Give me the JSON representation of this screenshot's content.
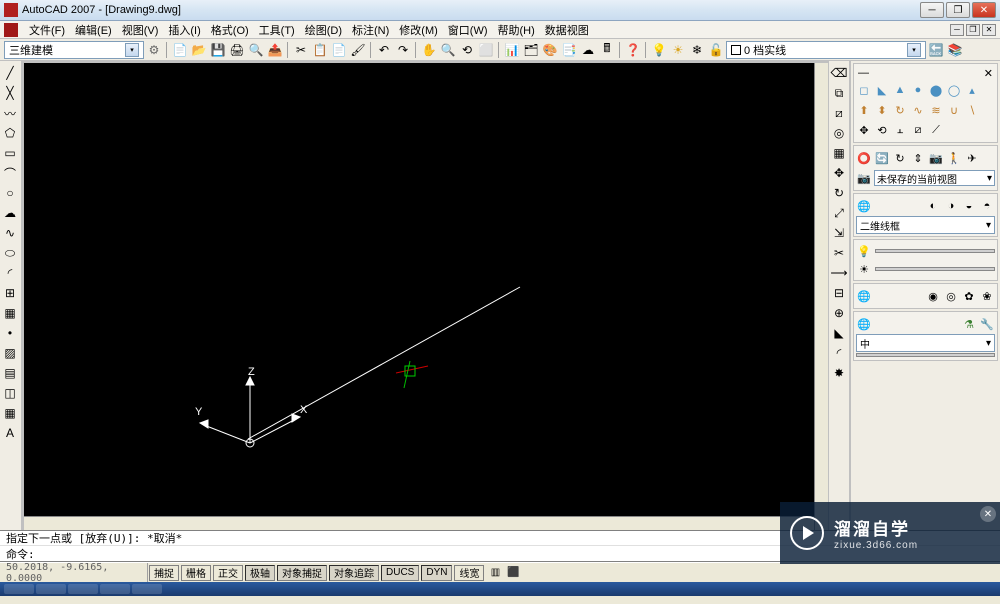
{
  "window": {
    "title": "AutoCAD 2007 - [Drawing9.dwg]"
  },
  "menu": [
    "文件(F)",
    "编辑(E)",
    "视图(V)",
    "插入(I)",
    "格式(O)",
    "工具(T)",
    "绘图(D)",
    "标注(N)",
    "修改(M)",
    "窗口(W)",
    "帮助(H)",
    "数据视图"
  ],
  "workspace": "三维建模",
  "layer_label": "0 档实线",
  "right_panel": {
    "view_dd": "未保存的当前视图",
    "style_dd": "二维线框",
    "hatch_dd": "中"
  },
  "command": {
    "output": "指定下一点或 [放弃(U)]: *取消*",
    "prompt": "命令:"
  },
  "status": {
    "coords": "50.2018, -9.6165, 0.0000",
    "buttons": [
      "捕捉",
      "栅格",
      "正交",
      "极轴",
      "对象捕捉",
      "对象追踪",
      "DUCS",
      "DYN",
      "线宽"
    ]
  },
  "ucs": {
    "x": "X",
    "y": "Y",
    "z": "Z"
  },
  "watermark": {
    "title": "溜溜自学",
    "sub": "zixue.3d66.com"
  }
}
